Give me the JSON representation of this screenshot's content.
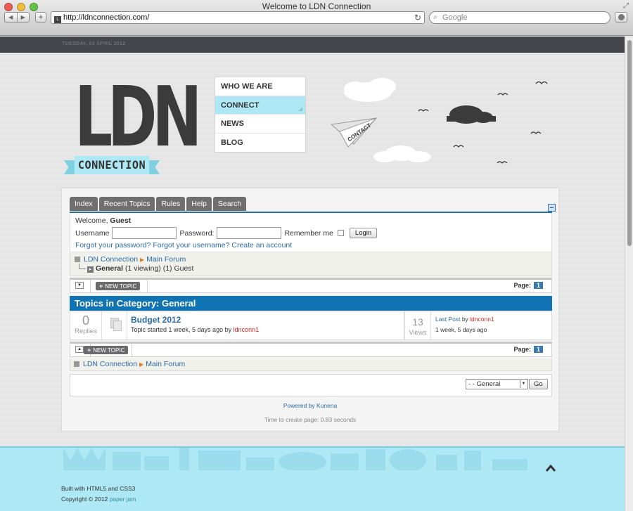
{
  "browser": {
    "title": "Welcome to LDN Connection",
    "url": "http://ldnconnection.com/",
    "search_placeholder": "Google"
  },
  "page": {
    "date": "TUESDAY, 03 APRIL 2012",
    "logo": {
      "letters": "LDN",
      "ribbon": "CONNECTION"
    },
    "nav": [
      "WHO WE ARE",
      "CONNECT",
      "NEWS",
      "BLOG"
    ],
    "plane_label": "CONTACT"
  },
  "forum": {
    "tabs": [
      "Index",
      "Recent Topics",
      "Rules",
      "Help",
      "Search"
    ],
    "login": {
      "welcome": "Welcome,",
      "guest": "Guest",
      "username_label": "Username",
      "password_label": "Password:",
      "remember_label": "Remember me",
      "login_button": "Login",
      "forgot_password": "Forgot your password?",
      "forgot_username": "Forgot your username?",
      "create_account": "Create an account"
    },
    "breadcrumb": {
      "root": "LDN Connection",
      "forum": "Main Forum"
    },
    "category_line": {
      "name": "General",
      "viewing": "(1 viewing) (1) Guest"
    },
    "new_topic": "NEW TOPIC",
    "page_label": "Page:",
    "page_num": "1",
    "category_title": "Topics in Category: General",
    "topic": {
      "replies": "0",
      "replies_label": "Replies",
      "title": "Budget 2012",
      "started": "Topic started 1 week, 5 days ago by",
      "author": "ldnconn1",
      "views": "13",
      "views_label": "Views",
      "last_post_label": "Last Post",
      "by": "by",
      "last_author": "ldnconn1",
      "last_time": "1 week, 5 days ago"
    },
    "jump": {
      "selected": "- - General",
      "go": "Go"
    },
    "powered": "Powered by Kunena",
    "timing": "Time to create page: 0.83 seconds"
  },
  "footer": {
    "built": "Built with HTML5 and CSS3",
    "copyright": "Copyright © 2012",
    "brand": "paper jam"
  }
}
